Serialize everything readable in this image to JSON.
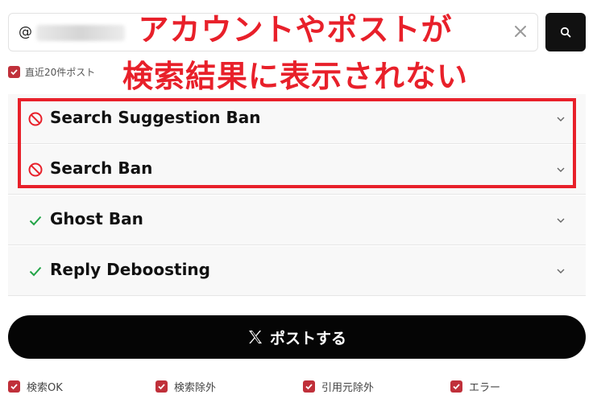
{
  "search": {
    "prefix": "@",
    "value_hidden": true,
    "clear_icon": "close-icon",
    "button_icon": "search-icon"
  },
  "headline": {
    "line1": "アカウントやポストが",
    "line2": "検索結果に表示されない",
    "color": "#e8202a"
  },
  "options": {
    "recent_label": "直近20件ポスト",
    "checked": true
  },
  "checks": [
    {
      "label": "Search Suggestion Ban",
      "status": "banned",
      "icon": "prohibited-icon"
    },
    {
      "label": "Search Ban",
      "status": "banned",
      "icon": "prohibited-icon"
    },
    {
      "label": "Ghost Ban",
      "status": "ok",
      "icon": "check-icon"
    },
    {
      "label": "Reply Deboosting",
      "status": "ok",
      "icon": "check-icon"
    }
  ],
  "post_button": {
    "label": "ポストする",
    "icon": "x-logo-icon"
  },
  "legend": [
    {
      "label": "検索OK",
      "checked": true
    },
    {
      "label": "検索除外",
      "checked": true
    },
    {
      "label": "引用元除外",
      "checked": true
    },
    {
      "label": "エラー",
      "checked": true
    }
  ],
  "colors": {
    "danger": "#e8202a",
    "ok": "#22a447",
    "checkbox": "#c0303a",
    "button": "#050505"
  }
}
